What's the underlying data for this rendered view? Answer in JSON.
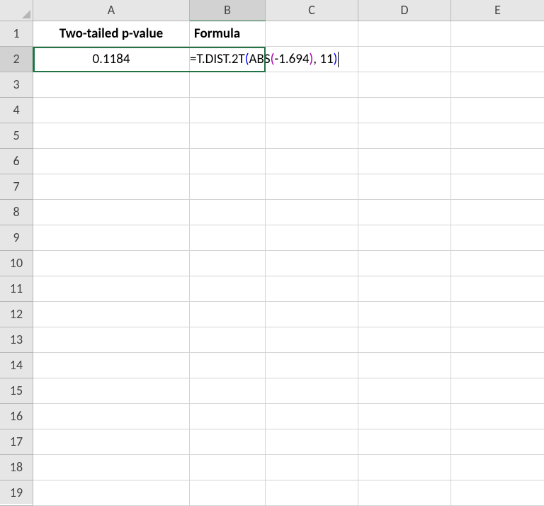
{
  "columns": [
    "A",
    "B",
    "C",
    "D",
    "E"
  ],
  "row_count": 19,
  "active_row": 2,
  "active_col": "B",
  "cells": {
    "A1": {
      "value": "Two-tailed p-value",
      "bold": true,
      "align": "center"
    },
    "B1": {
      "value": "Formula",
      "bold": true,
      "align": "left"
    },
    "A2": {
      "value": "0.1184",
      "align": "center"
    }
  },
  "editing": {
    "cell": "B2",
    "parts": [
      {
        "text": "=T.DIST.2T",
        "cls": "f-black"
      },
      {
        "text": "(",
        "cls": "f-blue"
      },
      {
        "text": "ABS",
        "cls": "f-black"
      },
      {
        "text": "(",
        "cls": "f-magenta"
      },
      {
        "text": "-1.694",
        "cls": "f-black"
      },
      {
        "text": ")",
        "cls": "f-magenta"
      },
      {
        "text": ", 11",
        "cls": "f-black"
      },
      {
        "text": ")",
        "cls": "f-blue"
      }
    ]
  }
}
